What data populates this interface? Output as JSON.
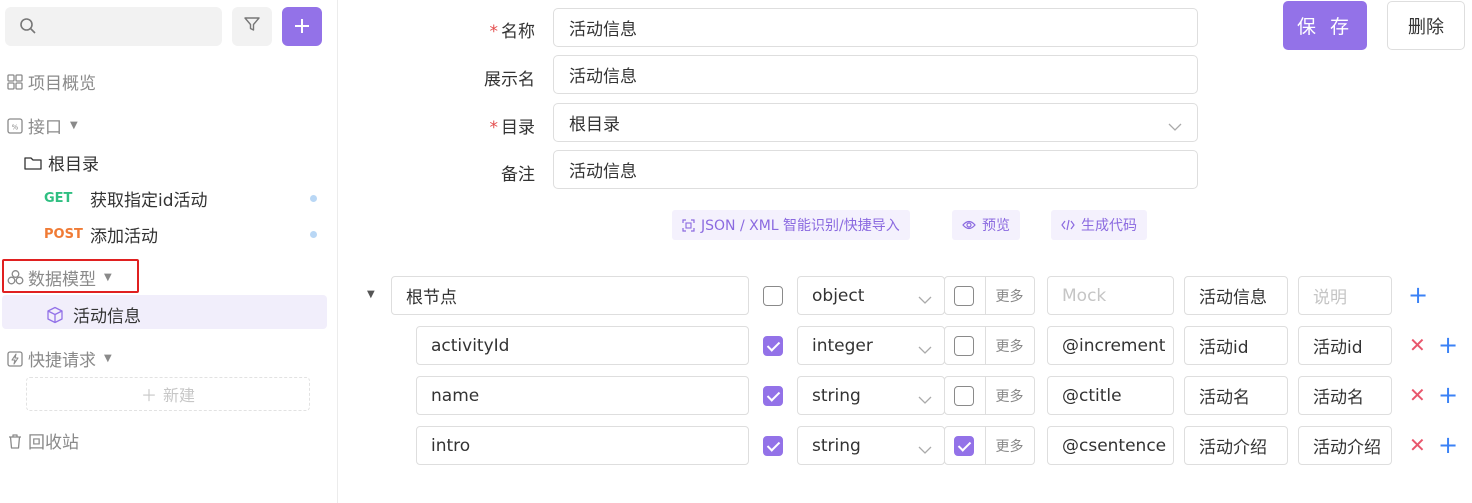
{
  "sidebar": {
    "nav": {
      "overview": "项目概览",
      "api": "接口",
      "models": "数据模型",
      "quick_requests": "快捷请求",
      "trash": "回收站"
    },
    "tree": {
      "root_folder": "根目录",
      "apis": [
        {
          "method": "GET",
          "name": "获取指定id活动"
        },
        {
          "method": "POST",
          "name": "添加活动"
        }
      ],
      "model_item": "活动信息",
      "new_label": "新建"
    }
  },
  "form": {
    "name_label": "名称",
    "name_value": "活动信息",
    "display_label": "展示名",
    "display_value": "活动信息",
    "dir_label": "目录",
    "dir_value": "根目录",
    "note_label": "备注",
    "note_value": "活动信息",
    "save": "保 存",
    "delete": "删除"
  },
  "tools": {
    "import": "JSON / XML 智能识别/快捷导入",
    "preview": "预览",
    "codegen": "生成代码"
  },
  "schema": {
    "more_label": "更多",
    "rows": [
      {
        "name": "根节点",
        "required": false,
        "type": "object",
        "nullable": false,
        "mock": "Mock",
        "mock_placeholder": true,
        "title": "活动信息",
        "desc": "说明",
        "desc_placeholder": true
      },
      {
        "name": "activityId",
        "required": true,
        "type": "integer",
        "nullable": false,
        "mock": "@increment",
        "title": "活动id",
        "desc": "活动id"
      },
      {
        "name": "name",
        "required": true,
        "type": "string",
        "nullable": false,
        "mock": "@ctitle",
        "title": "活动名",
        "desc": "活动名"
      },
      {
        "name": "intro",
        "required": true,
        "type": "string",
        "nullable": true,
        "mock": "@csentence",
        "title": "活动介绍",
        "desc": "活动介绍"
      }
    ]
  },
  "colors": {
    "accent": "#9372e8",
    "get": "#2fbf81",
    "post": "#f07b35",
    "highlight_box": "#e02020"
  }
}
